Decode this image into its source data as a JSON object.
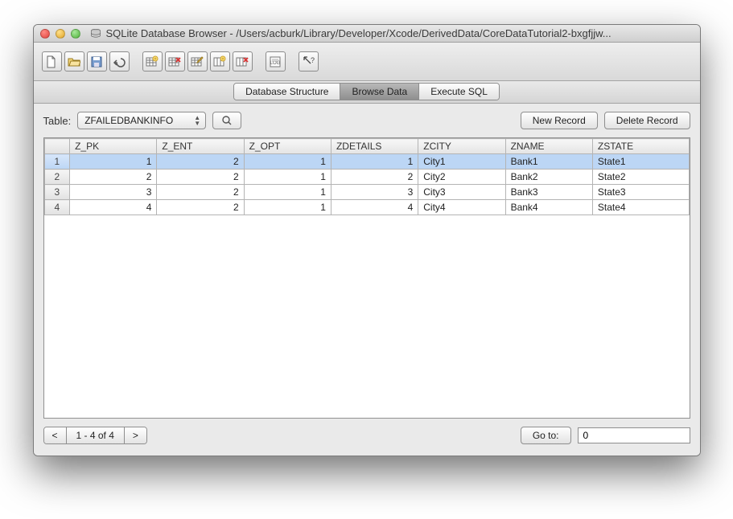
{
  "window": {
    "title": "SQLite Database Browser - /Users/acburk/Library/Developer/Xcode/DerivedData/CoreDataTutorial2-bxgfjjw..."
  },
  "tabs": {
    "structure": "Database Structure",
    "browse": "Browse Data",
    "execute": "Execute SQL",
    "active_index": 1
  },
  "controls": {
    "table_label": "Table:",
    "selected_table": "ZFAILEDBANKINFO",
    "new_record": "New Record",
    "delete_record": "Delete Record"
  },
  "table": {
    "columns": [
      "Z_PK",
      "Z_ENT",
      "Z_OPT",
      "ZDETAILS",
      "ZCITY",
      "ZNAME",
      "ZSTATE"
    ],
    "numeric_cols": [
      0,
      1,
      2,
      3
    ],
    "rows": [
      [
        "1",
        "2",
        "1",
        "1",
        "City1",
        "Bank1",
        "State1"
      ],
      [
        "2",
        "2",
        "1",
        "2",
        "City2",
        "Bank2",
        "State2"
      ],
      [
        "3",
        "2",
        "1",
        "3",
        "City3",
        "Bank3",
        "State3"
      ],
      [
        "4",
        "2",
        "1",
        "4",
        "City4",
        "Bank4",
        "State4"
      ]
    ],
    "selected_row": 0
  },
  "footer": {
    "prev": "<",
    "range": "1 - 4 of 4",
    "next": ">",
    "goto_label": "Go to:",
    "goto_value": "0"
  },
  "toolbar_icons": [
    "new-file-icon",
    "open-file-icon",
    "save-icon",
    "undo-icon",
    "create-table-icon",
    "delete-table-icon",
    "modify-table-icon",
    "add-column-icon",
    "delete-column-icon",
    "log-icon",
    "help-icon"
  ]
}
